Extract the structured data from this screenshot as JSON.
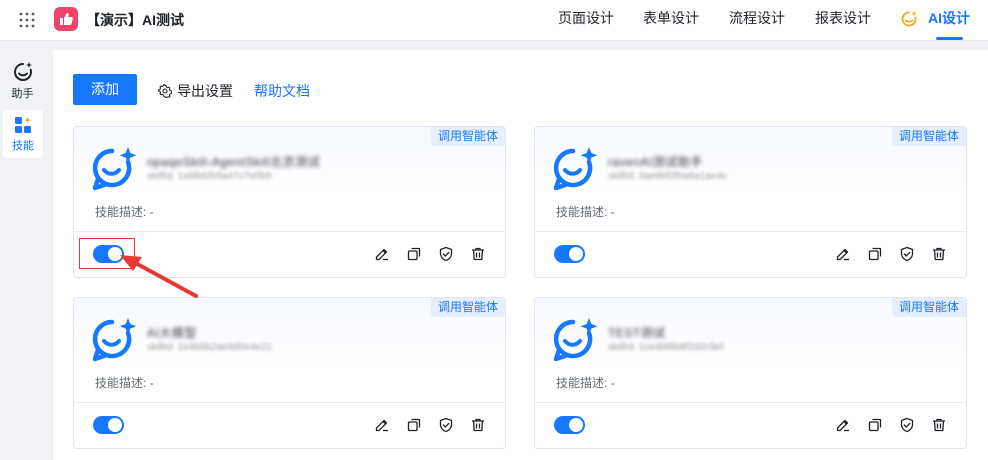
{
  "header": {
    "app_title": "【演示】AI测试",
    "nav": [
      {
        "label": "页面设计"
      },
      {
        "label": "表单设计"
      },
      {
        "label": "流程设计"
      },
      {
        "label": "报表设计"
      },
      {
        "label": "AI设计",
        "active": true
      }
    ]
  },
  "sidebar": {
    "items": [
      {
        "label": "助手",
        "icon": "assistant-icon"
      },
      {
        "label": "技能",
        "icon": "skill-icon",
        "active": true
      }
    ]
  },
  "toolbar": {
    "add_label": "添加",
    "export_label": "导出设置",
    "help_label": "帮助文档"
  },
  "cards": [
    {
      "tag": "调用智能体",
      "name": "opaqeSkill-AgentSkill北京测试",
      "sub": "skillId: 1a98d2b5a47c7e0b5",
      "desc": "技能描述: -",
      "enabled": true
    },
    {
      "tag": "调用智能体",
      "name": "ravenAI测试助手",
      "sub": "skillId: 3ae6bf2f0a6a1ae4c",
      "desc": "技能描述: -",
      "enabled": true
    },
    {
      "tag": "调用智能体",
      "name": "AI大模型",
      "sub": "skillId: 1e4b5b2ae8d0e4e21",
      "desc": "技能描述: -",
      "enabled": true
    },
    {
      "tag": "调用智能体",
      "name": "TEST测试",
      "sub": "skillId: 1ce4bf8b8f2d2c9ef",
      "desc": "技能描述: -",
      "enabled": true
    }
  ],
  "colors": {
    "accent": "#1677ff",
    "highlight": "#e53935",
    "brand_logo": "#f0446a"
  }
}
